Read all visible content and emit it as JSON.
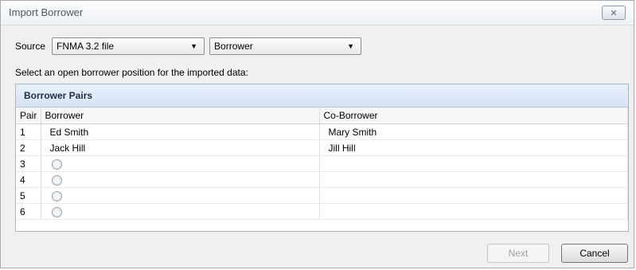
{
  "window": {
    "title": "Import Borrower",
    "close_symbol": "✕"
  },
  "source": {
    "label": "Source",
    "file_type": "FNMA 3.2 file",
    "entity": "Borrower"
  },
  "instruction": "Select an open borrower position for the imported data:",
  "grid": {
    "header": "Borrower Pairs",
    "columns": [
      "Pair",
      "Borrower",
      "Co-Borrower"
    ],
    "rows": [
      {
        "pair": "1",
        "borrower": "Ed Smith",
        "co_borrower": "Mary Smith"
      },
      {
        "pair": "2",
        "borrower": "Jack Hill",
        "co_borrower": "Jill Hill"
      },
      {
        "pair": "3",
        "borrower": "",
        "co_borrower": ""
      },
      {
        "pair": "4",
        "borrower": "",
        "co_borrower": ""
      },
      {
        "pair": "5",
        "borrower": "",
        "co_borrower": ""
      },
      {
        "pair": "6",
        "borrower": "",
        "co_borrower": ""
      }
    ]
  },
  "buttons": {
    "next": "Next",
    "cancel": "Cancel"
  },
  "colors": {
    "header_bg": "#dbe6f5",
    "dialog_bg": "#f0f0f0",
    "disabled_text": "#9ea3a8"
  }
}
